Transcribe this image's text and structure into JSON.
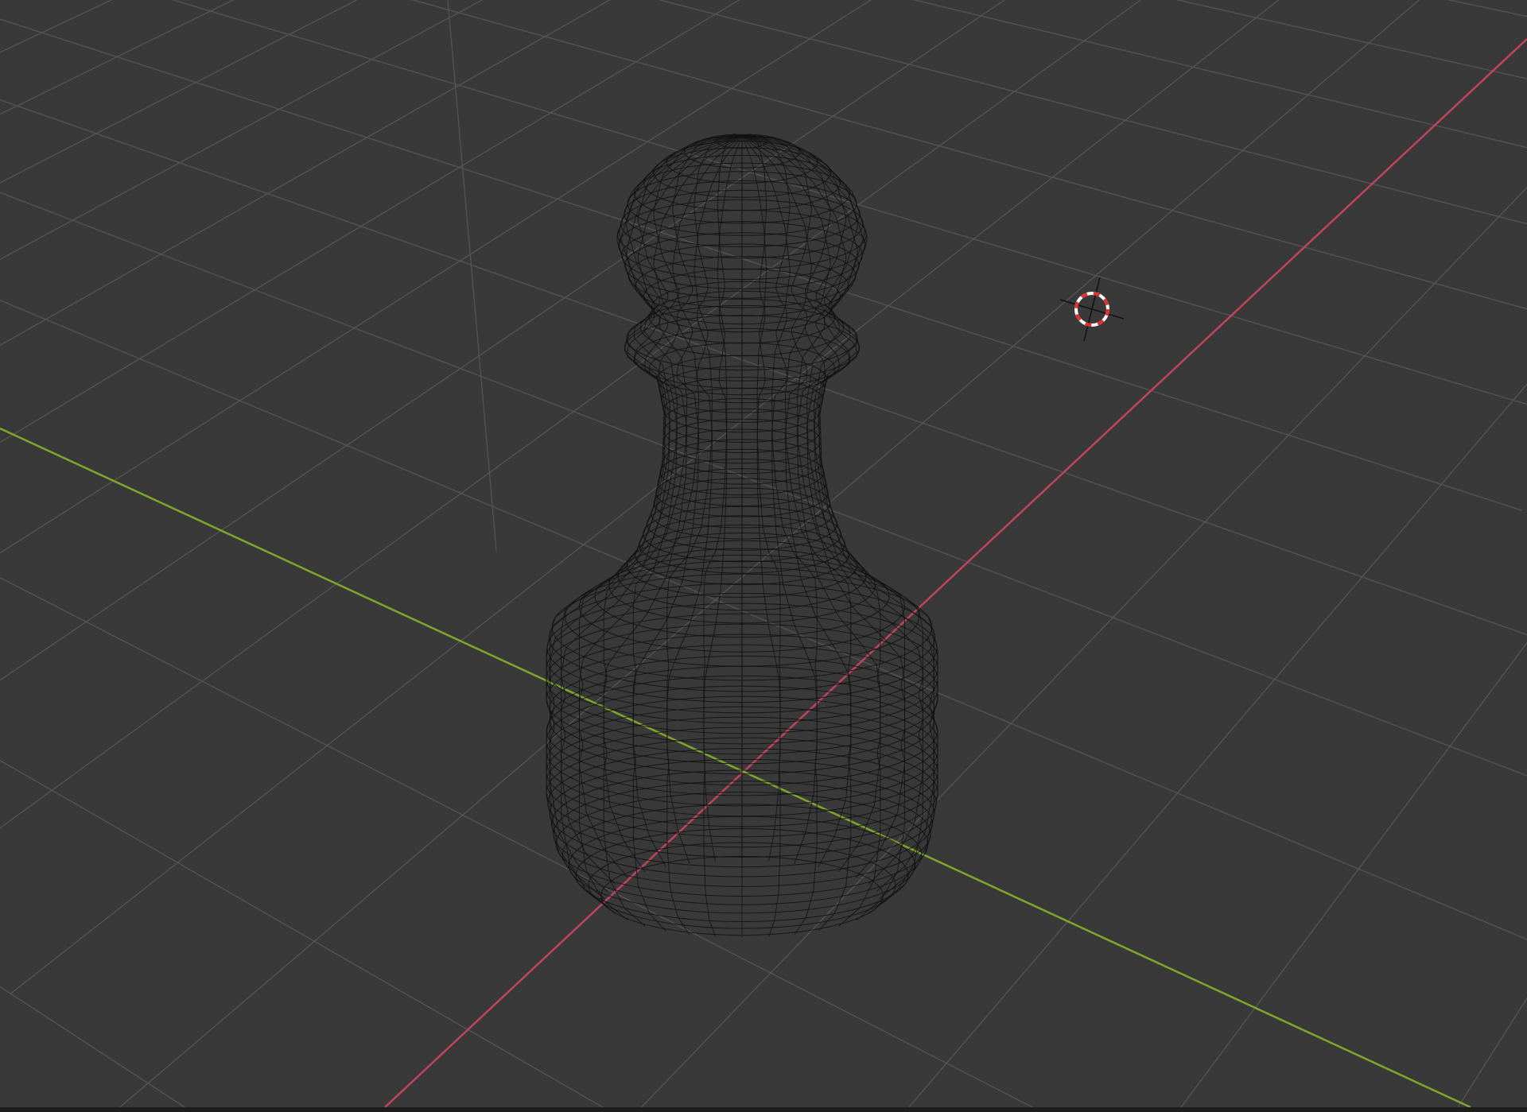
{
  "app": "3D viewport",
  "viewport": {
    "shading_mode": "wireframe",
    "object": "pawn",
    "colors": {
      "background": "#393939",
      "grid": "#555555",
      "x_axis": "#c0455a",
      "y_axis": "#7fa82a",
      "wire": "#111111",
      "cursor_red": "#e03030",
      "cursor_white": "#ffffff"
    }
  }
}
